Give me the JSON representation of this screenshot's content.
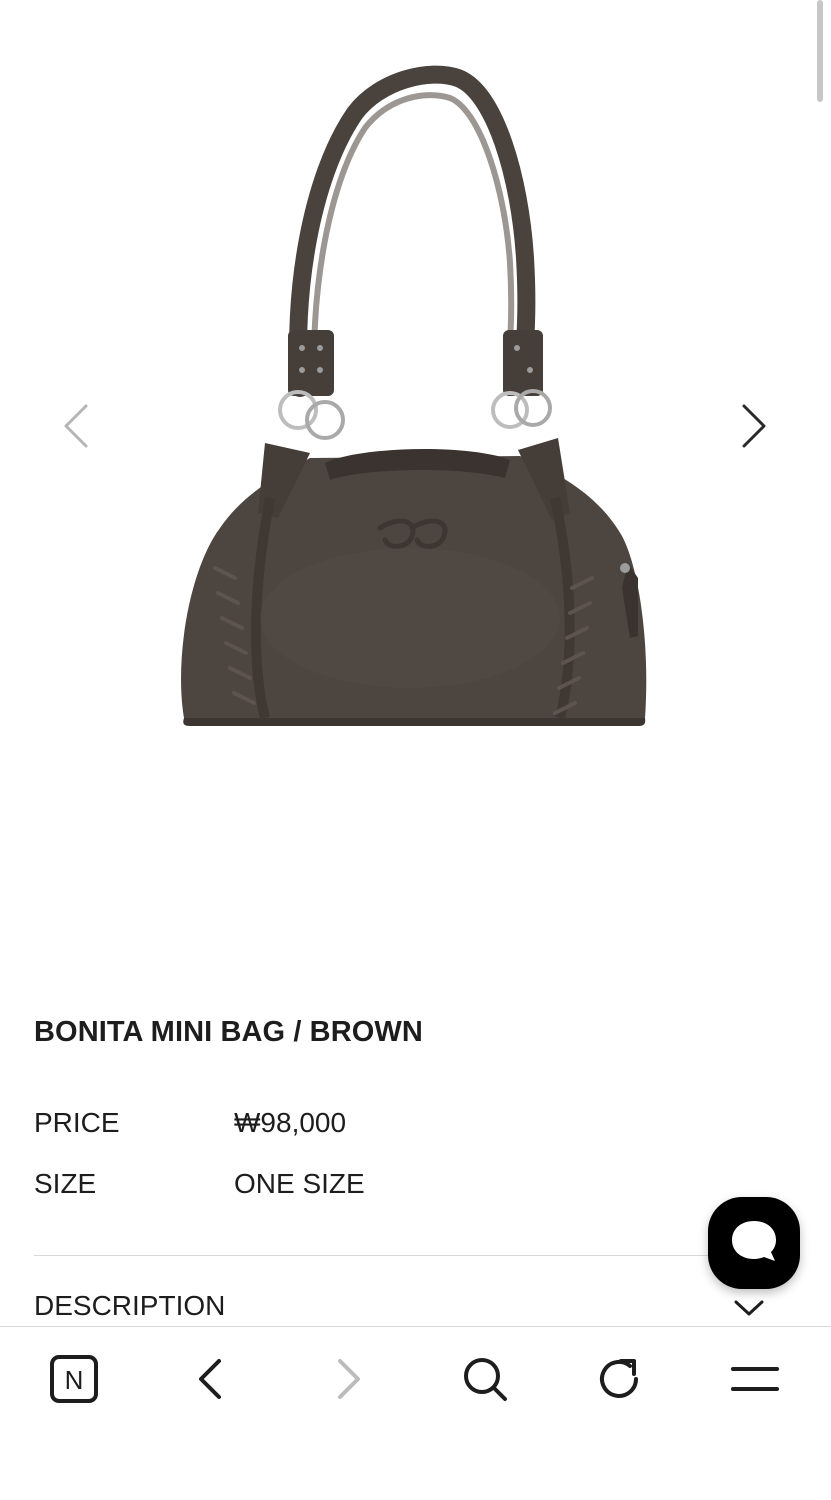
{
  "product": {
    "title": "BONITA MINI BAG / BROWN",
    "specs": [
      {
        "label": "PRICE",
        "value": "₩98,000"
      },
      {
        "label": "SIZE",
        "value": "ONE SIZE"
      }
    ],
    "description_label": "DESCRIPTION",
    "bag_color": "#4d4540"
  },
  "gallery": {
    "prev_icon": "chevron-left-icon",
    "next_icon": "chevron-right-icon"
  },
  "chat": {
    "icon": "chat-bubble-icon",
    "background": "#000000"
  },
  "browser_toolbar": {
    "items": [
      {
        "name": "naver-home-button",
        "icon": "n-logo-icon",
        "label": "N",
        "enabled": true
      },
      {
        "name": "back-button",
        "icon": "chevron-left-icon",
        "enabled": true
      },
      {
        "name": "forward-button",
        "icon": "chevron-right-icon",
        "enabled": false
      },
      {
        "name": "search-button",
        "icon": "search-icon",
        "enabled": true
      },
      {
        "name": "reload-button",
        "icon": "reload-icon",
        "enabled": true
      },
      {
        "name": "menu-button",
        "icon": "menu-icon",
        "enabled": true
      }
    ]
  },
  "colors": {
    "text": "#1d1d1d",
    "muted_arrow": "#b5b5b5",
    "divider": "#d8d8d8",
    "disabled_icon": "#bcbcbc"
  }
}
